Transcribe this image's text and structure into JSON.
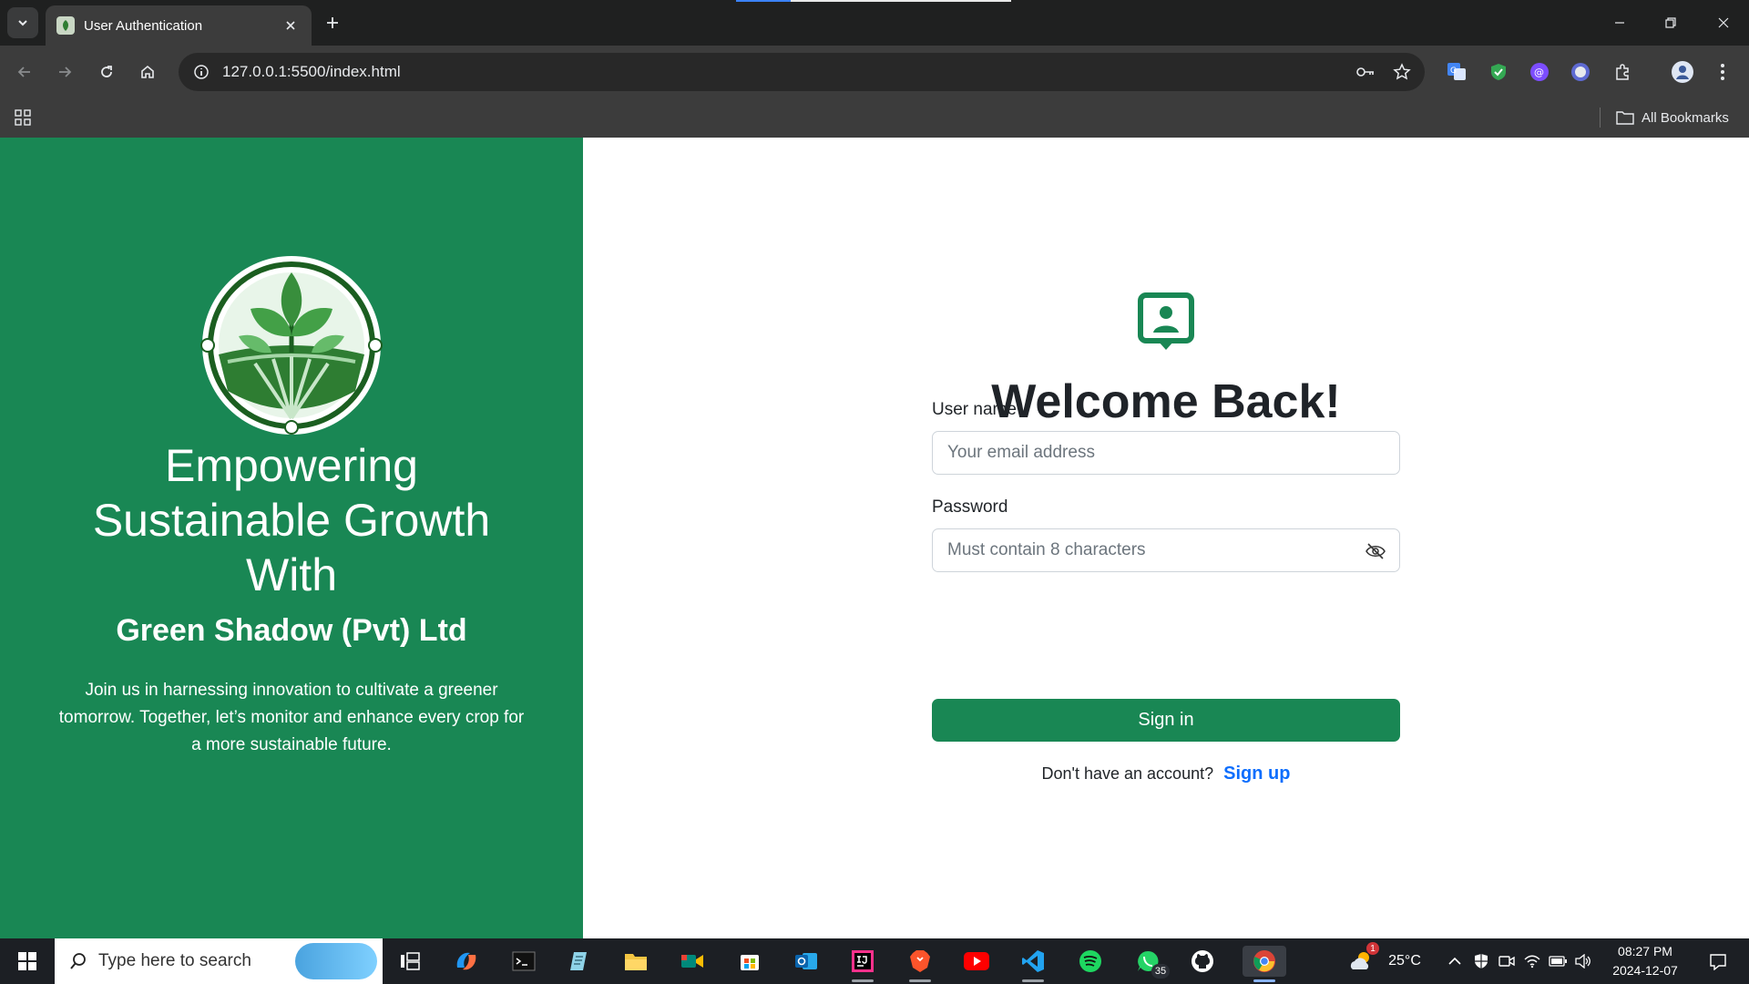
{
  "browser": {
    "tab_title": "User Authentication",
    "url": "127.0.0.1:5500/index.html",
    "bookmarks_label": "All Bookmarks"
  },
  "left_panel": {
    "title": "Empowering Sustainable Growth With",
    "subtitle": "Green Shadow (Pvt) Ltd",
    "description": "Join us in harnessing innovation to cultivate a greener tomorrow. Together, let’s monitor and enhance every crop for a more sustainable future."
  },
  "login": {
    "heading": "Welcome Back!",
    "username_label": "User name",
    "username_placeholder": "Your email address",
    "password_label": "Password",
    "password_placeholder": "Must contain 8 characters",
    "signin_label": "Sign in",
    "no_account_text": "Don't have an account?",
    "signup_label": "Sign up"
  },
  "taskbar": {
    "search_placeholder": "Type here to search",
    "whatsapp_badge": "35",
    "weather_badge": "1",
    "temperature": "25°C",
    "time": "08:27 PM",
    "date": "2024-12-07"
  },
  "colors": {
    "brand_green": "#198754",
    "link_blue": "#0d6efd"
  }
}
